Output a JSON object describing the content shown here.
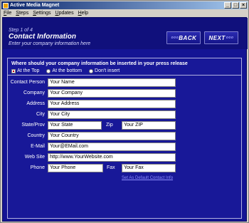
{
  "window": {
    "title": "Active Media Magnet"
  },
  "menu": [
    {
      "label": "File"
    },
    {
      "label": "Steps"
    },
    {
      "label": "Settings"
    },
    {
      "label": "Updates"
    },
    {
      "label": "Help"
    }
  ],
  "header": {
    "step": "Step 1 of 4",
    "title": "Contact Information",
    "subtitle": "Enter your company information here",
    "back_label": "BACK",
    "next_label": "NEXT"
  },
  "placement": {
    "question": "Where should your company information be inserted in your press release",
    "options": [
      "At the Top",
      "At the bottom",
      "Don't insert"
    ],
    "selected": "At the Top"
  },
  "fields": {
    "contact_person": {
      "label": "Contact Person",
      "value": "Your Name"
    },
    "company": {
      "label": "Company",
      "value": "Your Company"
    },
    "address": {
      "label": "Address",
      "value": "Your Address"
    },
    "city": {
      "label": "City",
      "value": "Your City"
    },
    "state": {
      "label": "State/Prov",
      "value": "Your State"
    },
    "zip": {
      "label": "Zip",
      "value": "Your ZIP"
    },
    "country": {
      "label": "Country",
      "value": "Your Country"
    },
    "email": {
      "label": "E-Mail",
      "value": "Your@EMail.com"
    },
    "website": {
      "label": "Web Site",
      "value": "http://www.YourWebsite.com"
    },
    "phone": {
      "label": "Phone",
      "value": "Your Phone"
    },
    "fax": {
      "label": "Fax",
      "value": "Your Fax"
    }
  },
  "reset_link": "Set As Default Contact Info",
  "icons": {
    "app": "app-icon",
    "minimize": "minimize-icon",
    "maximize": "maximize-icon",
    "close": "close-icon"
  }
}
